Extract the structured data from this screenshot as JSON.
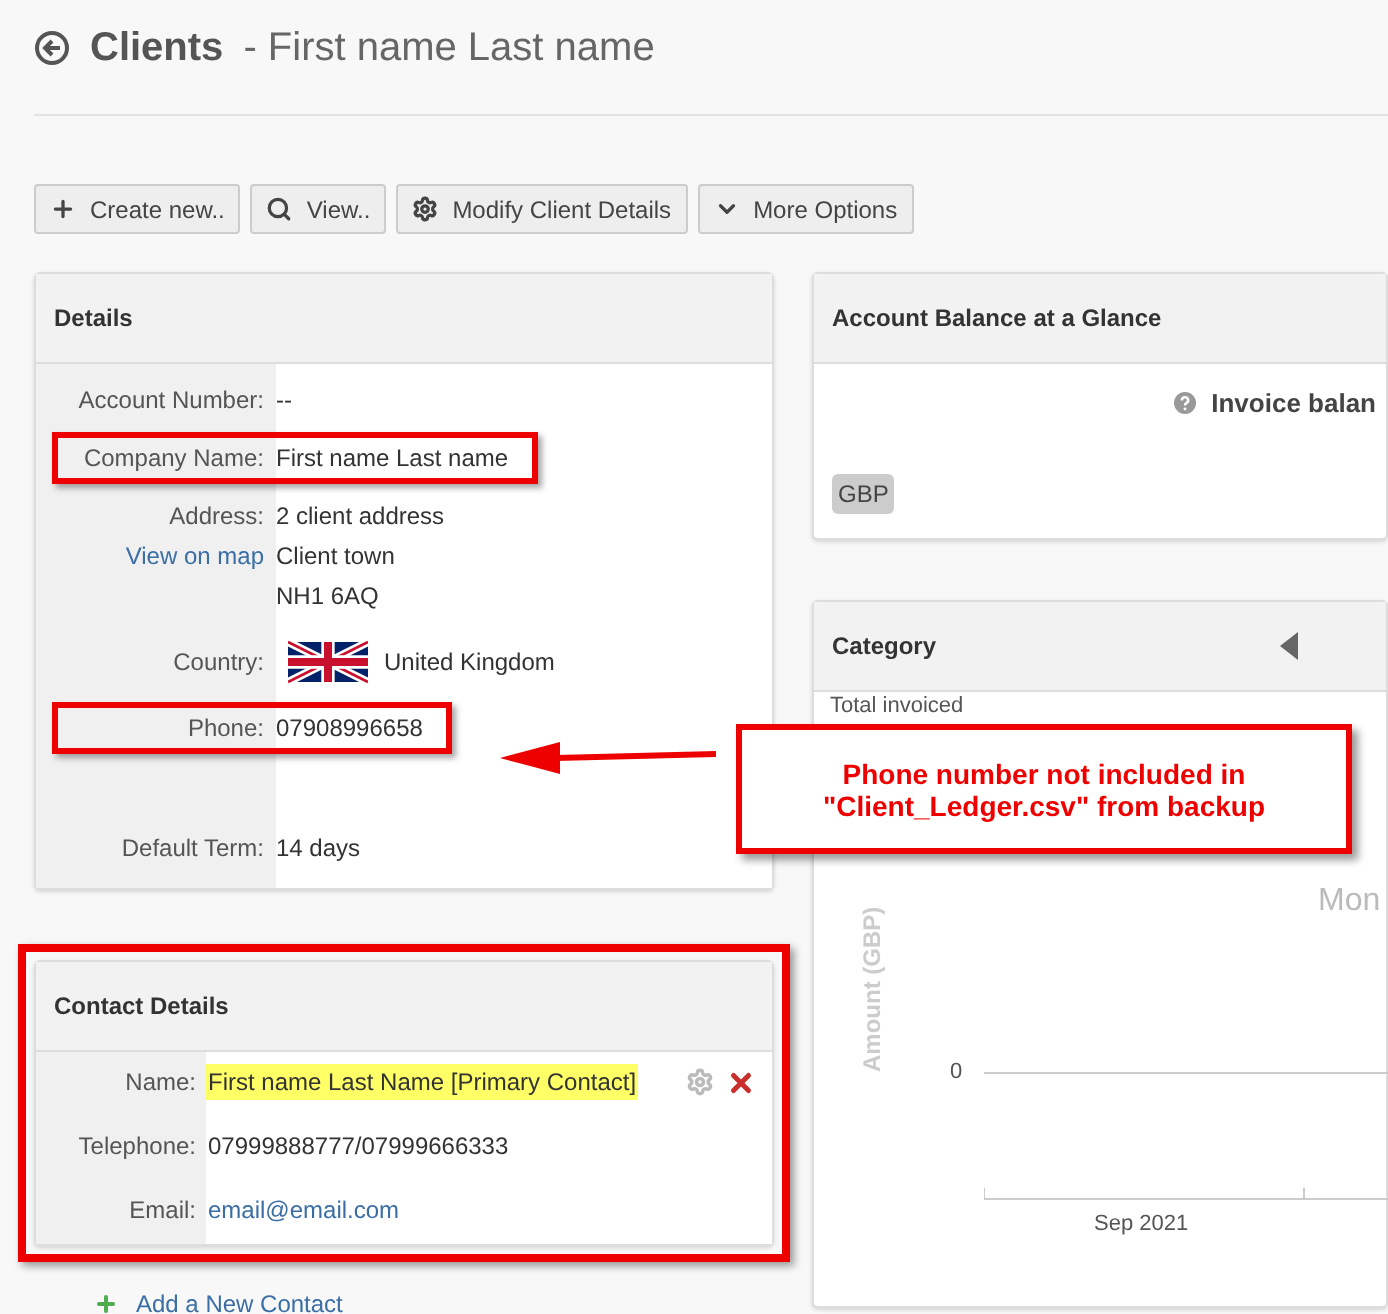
{
  "header": {
    "title": "Clients",
    "subtitle": "- First name Last name"
  },
  "toolbar": [
    "Create new..",
    "View..",
    "Modify Client Details",
    "More Options"
  ],
  "details": {
    "title": "Details",
    "rows": [
      {
        "kind": "text",
        "label": "Account Number:",
        "lines": [
          "--"
        ],
        "annotated": false
      },
      {
        "kind": "text",
        "label": "Company Name:",
        "lines": [
          "First name Last name"
        ],
        "annotated": true
      },
      {
        "kind": "text",
        "label": "Address:",
        "link": "View on map",
        "lines": [
          "2 client address",
          "Client town",
          "NH1 6AQ"
        ],
        "annotated": false
      },
      {
        "kind": "flag",
        "label": "Country:",
        "lines": [
          "United Kingdom"
        ],
        "annotated": false
      },
      {
        "kind": "text",
        "label": "Phone:",
        "lines": [
          "07908996658"
        ],
        "annotated": true
      },
      {
        "kind": "text",
        "label": "Default Term:",
        "lines": [
          "14 days"
        ],
        "annotated": false
      }
    ]
  },
  "contact": {
    "title": "Contact Details",
    "annotated": true,
    "rows": [
      {
        "kind": "name",
        "label": "Name:",
        "value": "First name Last Name [Primary Contact]",
        "highlighted": true
      },
      {
        "kind": "text",
        "label": "Telephone:",
        "value": "07999888777/07999666333",
        "highlighted": false
      },
      {
        "kind": "link",
        "label": "Email:",
        "value": "email@email.com",
        "highlighted": false
      }
    ],
    "add_link": "Add a New Contact"
  },
  "balance": {
    "title": "Account Balance at a Glance",
    "column": "Invoice balan",
    "currency": "GBP"
  },
  "category": {
    "title": "Category",
    "total_label": "Total invoiced",
    "chart_title": "Mon",
    "ylabel": "Amount (GBP)",
    "ytick": "0",
    "xtick": "Sep 2021"
  },
  "callout": {
    "lines": [
      "Phone number not included in",
      "\"Client_Ledger.csv\" from backup"
    ]
  }
}
